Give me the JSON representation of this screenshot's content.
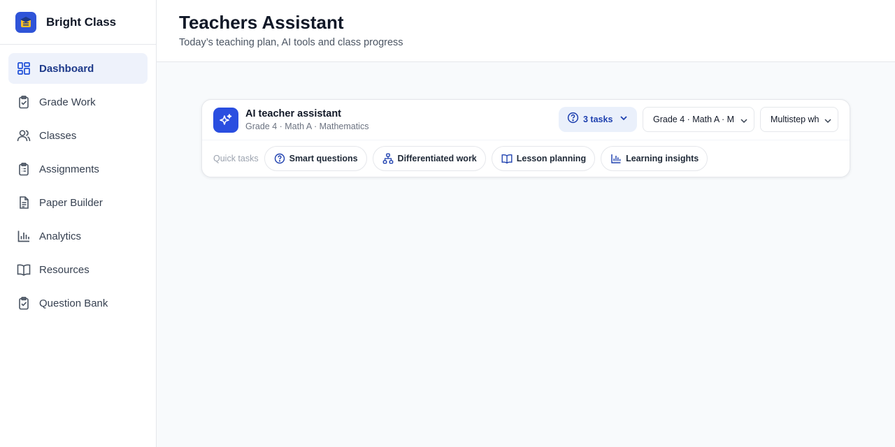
{
  "brand": {
    "name": "Bright Class",
    "logo_icon": "graduation-cap-icon",
    "accent": "#2f54d8"
  },
  "sidebar": {
    "items": [
      {
        "label": "Dashboard",
        "icon": "dashboard-icon",
        "active": true
      },
      {
        "label": "Grade Work",
        "icon": "clipboard-check-icon"
      },
      {
        "label": "Classes",
        "icon": "users-icon"
      },
      {
        "label": "Assignments",
        "icon": "clipboard-list-icon"
      },
      {
        "label": "Paper Builder",
        "icon": "document-icon"
      },
      {
        "label": "Analytics",
        "icon": "bar-chart-icon"
      },
      {
        "label": "Resources",
        "icon": "book-open-icon"
      },
      {
        "label": "Question Bank",
        "icon": "clipboard-check-icon"
      }
    ]
  },
  "header": {
    "title": "Teachers Assistant",
    "subtitle": "Today’s teaching plan, AI tools and class progress"
  },
  "assistant": {
    "title": "AI teacher assistant",
    "subtitle": "Grade 4 · Math A · Mathematics",
    "icon": "sparkles-icon",
    "tasks_label": "3 tasks",
    "class_select": "Grade 4 · Math A · M",
    "topic_select": "Multistep wh",
    "quick_tasks_label": "Quick tasks",
    "quick_tasks": [
      {
        "label": "Smart questions",
        "icon": "question-circle-icon"
      },
      {
        "label": "Differentiated work",
        "icon": "hierarchy-icon"
      },
      {
        "label": "Lesson planning",
        "icon": "book-open-icon"
      },
      {
        "label": "Learning insights",
        "icon": "bar-chart-icon"
      }
    ]
  }
}
